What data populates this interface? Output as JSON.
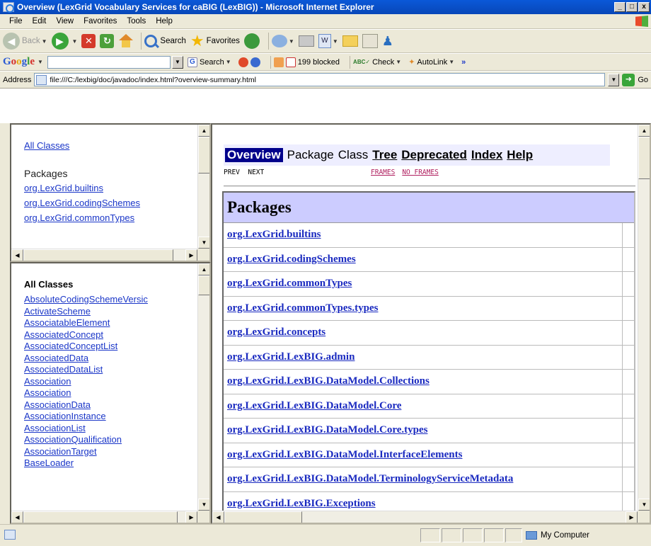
{
  "window": {
    "title": "Overview (LexGrid Vocabulary Services for caBIG (LexBIG)) - Microsoft Internet Explorer",
    "min": "_",
    "max": "□",
    "close": "x"
  },
  "menu": [
    "File",
    "Edit",
    "View",
    "Favorites",
    "Tools",
    "Help"
  ],
  "toolbar": {
    "back": "Back",
    "search": "Search",
    "favorites": "Favorites"
  },
  "googlebar": {
    "logo": "Google",
    "search": "Search",
    "blocked": "199 blocked",
    "check": "Check",
    "autolink": "AutoLink",
    "more": "»"
  },
  "address": {
    "label": "Address",
    "url": "file:///C:/lexbig/doc/javadoc/index.html?overview-summary.html",
    "go": "Go"
  },
  "top_left_frame": {
    "all_classes": "All Classes",
    "packages_heading": "Packages",
    "packages": [
      "org.LexGrid.builtins",
      "org.LexGrid.codingSchemes",
      "org.LexGrid.commonTypes"
    ]
  },
  "bottom_left_frame": {
    "heading": "All Classes",
    "classes": [
      "AbsoluteCodingSchemeVersic",
      "ActivateScheme",
      "AssociatableElement",
      "AssociatedConcept",
      "AssociatedConceptList",
      "AssociatedData",
      "AssociatedDataList",
      "Association",
      "Association",
      "AssociationData",
      "AssociationInstance",
      "AssociationList",
      "AssociationQualification",
      "AssociationTarget",
      "BaseLoader"
    ]
  },
  "main_frame": {
    "nav": {
      "overview": "Overview",
      "package": "Package",
      "class": "Class",
      "tree": "Tree",
      "deprecated": "Deprecated",
      "index": "Index",
      "help": "Help"
    },
    "prev": "PREV",
    "next": "NEXT",
    "frames": "FRAMES",
    "no_frames": "NO FRAMES",
    "table_heading": "Packages",
    "packages": [
      "org.LexGrid.builtins",
      "org.LexGrid.codingSchemes",
      "org.LexGrid.commonTypes",
      "org.LexGrid.commonTypes.types",
      "org.LexGrid.concepts",
      "org.LexGrid.LexBIG.admin",
      "org.LexGrid.LexBIG.DataModel.Collections",
      "org.LexGrid.LexBIG.DataModel.Core",
      "org.LexGrid.LexBIG.DataModel.Core.types",
      "org.LexGrid.LexBIG.DataModel.InterfaceElements",
      "org.LexGrid.LexBIG.DataModel.TerminologyServiceMetadata",
      "org.LexGrid.LexBIG.Exceptions"
    ]
  },
  "status": {
    "zone": "My Computer"
  }
}
